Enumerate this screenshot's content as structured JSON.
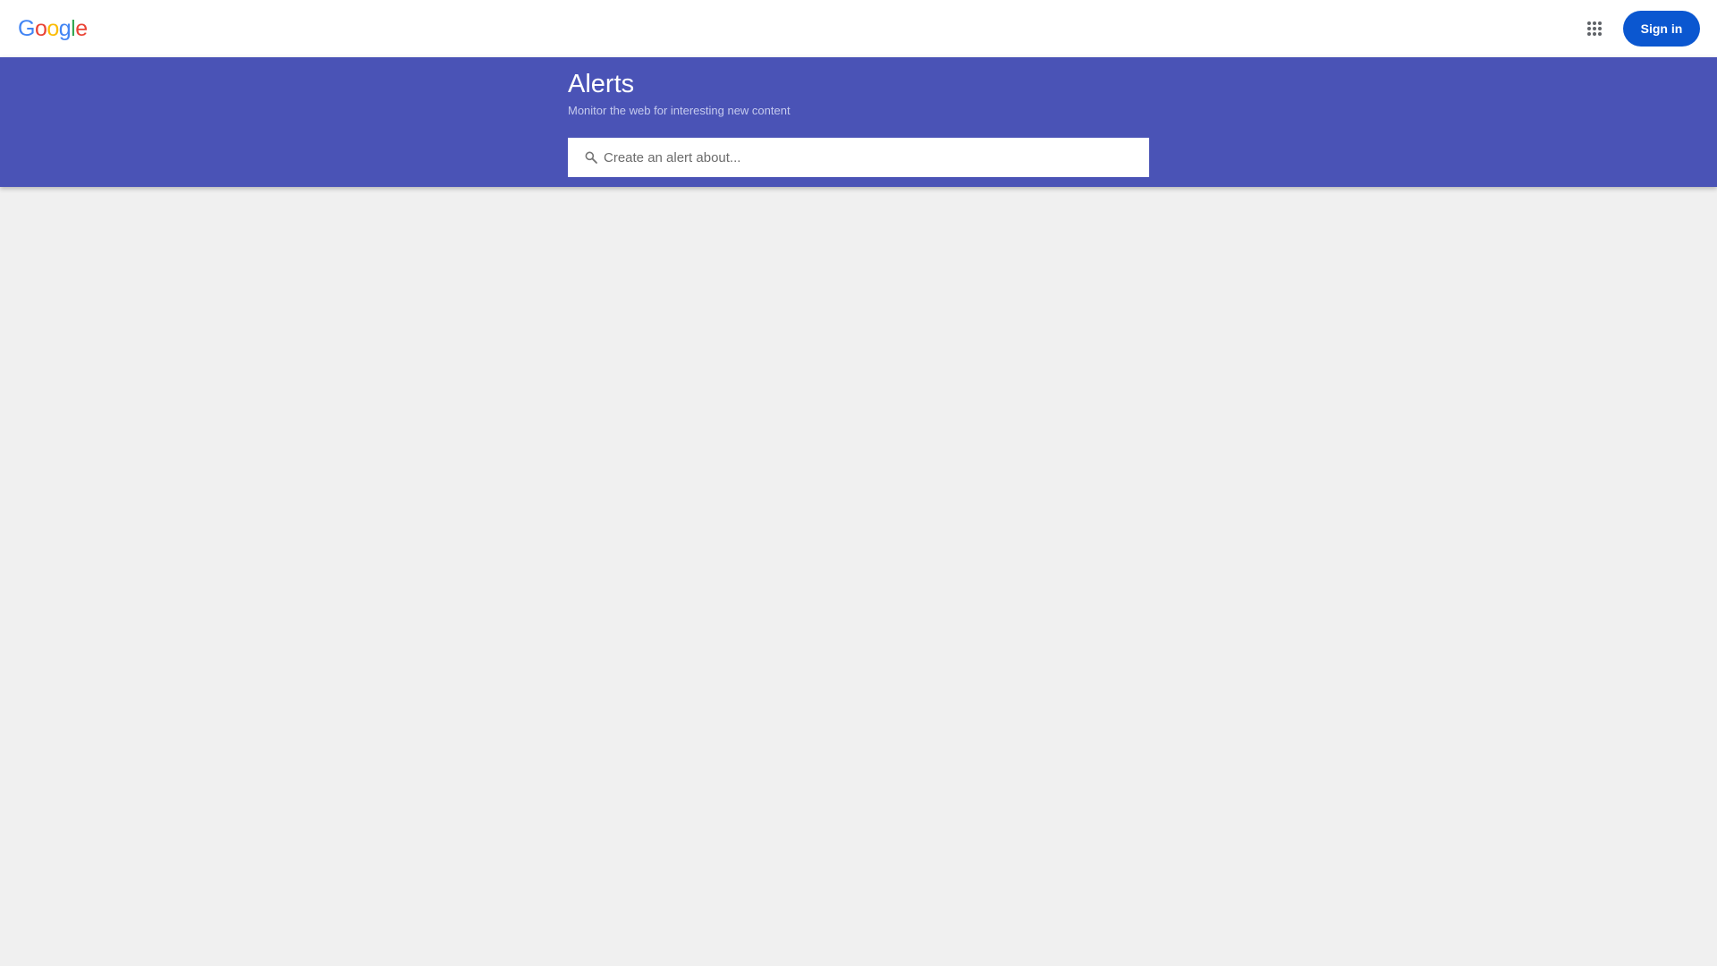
{
  "header": {
    "logo_letters": [
      {
        "char": "G",
        "color": "#4285f4"
      },
      {
        "char": "o",
        "color": "#ea4335"
      },
      {
        "char": "o",
        "color": "#fbbc05"
      },
      {
        "char": "g",
        "color": "#4285f4"
      },
      {
        "char": "l",
        "color": "#34a853"
      },
      {
        "char": "e",
        "color": "#ea4335"
      }
    ],
    "apps_icon": "apps-grid-icon",
    "signin_label": "Sign in",
    "signin_color": "#0b57d0"
  },
  "banner": {
    "title": "Alerts",
    "subtitle": "Monitor the web for interesting new content",
    "background": "#4a53b6"
  },
  "search": {
    "icon": "search-icon",
    "placeholder": "Create an alert about..."
  },
  "page": {
    "background": "#f0f0f0"
  }
}
